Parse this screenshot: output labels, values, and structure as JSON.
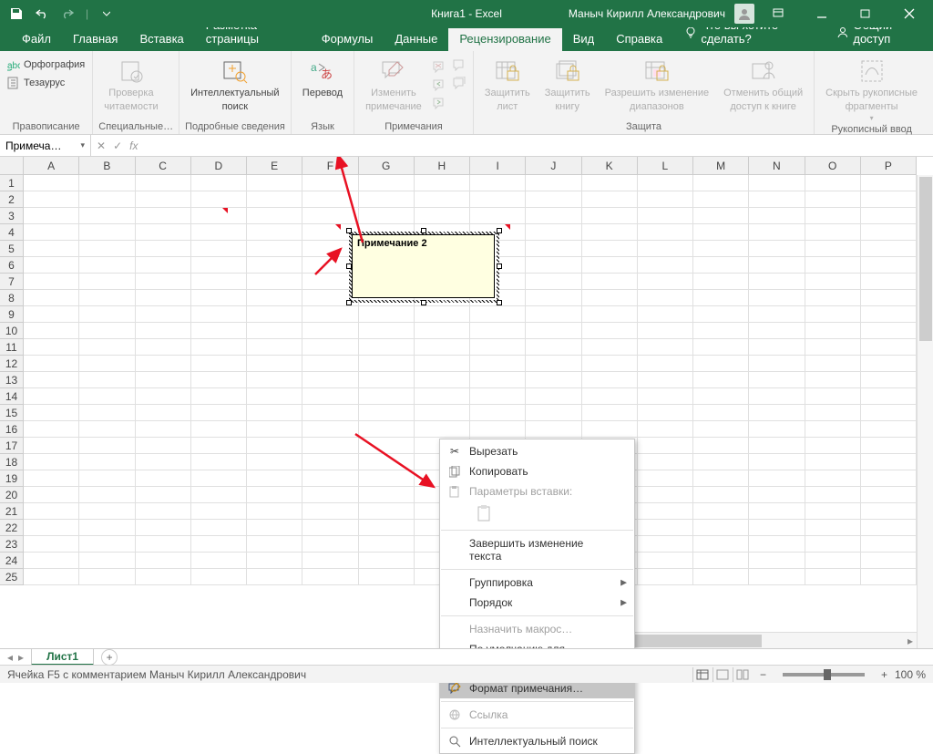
{
  "titlebar": {
    "doc_title": "Книга1  -  Excel",
    "user": "Маныч Кирилл Александрович"
  },
  "tabs": {
    "file": "Файл",
    "home": "Главная",
    "insert": "Вставка",
    "layout": "Разметка страницы",
    "formulas": "Формулы",
    "data": "Данные",
    "review": "Рецензирование",
    "view": "Вид",
    "help": "Справка",
    "tellme": "Что вы хотите сделать?",
    "share": "Общий доступ"
  },
  "ribbon": {
    "proofing": {
      "spell": "Орфография",
      "thesaurus": "Тезаурус",
      "label": "Правописание"
    },
    "access": {
      "check1": "Проверка",
      "check2": "читаемости",
      "label": "Специальные…"
    },
    "insights": {
      "smart1": "Интеллектуальный",
      "smart2": "поиск",
      "label": "Подробные сведения"
    },
    "lang": {
      "translate": "Перевод",
      "label": "Язык"
    },
    "comments": {
      "edit1": "Изменить",
      "edit2": "примечание",
      "label": "Примечания"
    },
    "protect": {
      "sheet1": "Защитить",
      "sheet2": "лист",
      "book1": "Защитить",
      "book2": "книгу",
      "ranges1": "Разрешить изменение",
      "ranges2": "диапазонов",
      "unshare1": "Отменить общий",
      "unshare2": "доступ к книге",
      "label": "Защита"
    },
    "ink": {
      "hide1": "Скрыть рукописные",
      "hide2": "фрагменты",
      "label": "Рукописный ввод"
    }
  },
  "namebox": "Примеча…",
  "columns": [
    "A",
    "B",
    "C",
    "D",
    "E",
    "F",
    "G",
    "H",
    "I",
    "J",
    "K",
    "L",
    "M",
    "N",
    "O",
    "P"
  ],
  "rows": [
    "1",
    "2",
    "3",
    "4",
    "5",
    "6",
    "7",
    "8",
    "9",
    "10",
    "11",
    "12",
    "13",
    "14",
    "15",
    "16",
    "17",
    "18",
    "19",
    "20",
    "21",
    "22",
    "23",
    "24",
    "25"
  ],
  "comment": {
    "text": "Примечание 2"
  },
  "context_menu": {
    "cut": "Вырезать",
    "copy": "Копировать",
    "paste_opts": "Параметры вставки:",
    "end_text": "Завершить изменение текста",
    "group": "Группировка",
    "order": "Порядок",
    "assign_macro": "Назначить макрос…",
    "default_shape": "По умолчанию для автофигур",
    "format_comment": "Формат примечания…",
    "link": "Ссылка",
    "smart_lookup": "Интеллектуальный поиск"
  },
  "sheet": {
    "name": "Лист1"
  },
  "status": {
    "text": "Ячейка F5 с комментарием Маныч Кирилл Александрович",
    "zoom": "100 %"
  }
}
